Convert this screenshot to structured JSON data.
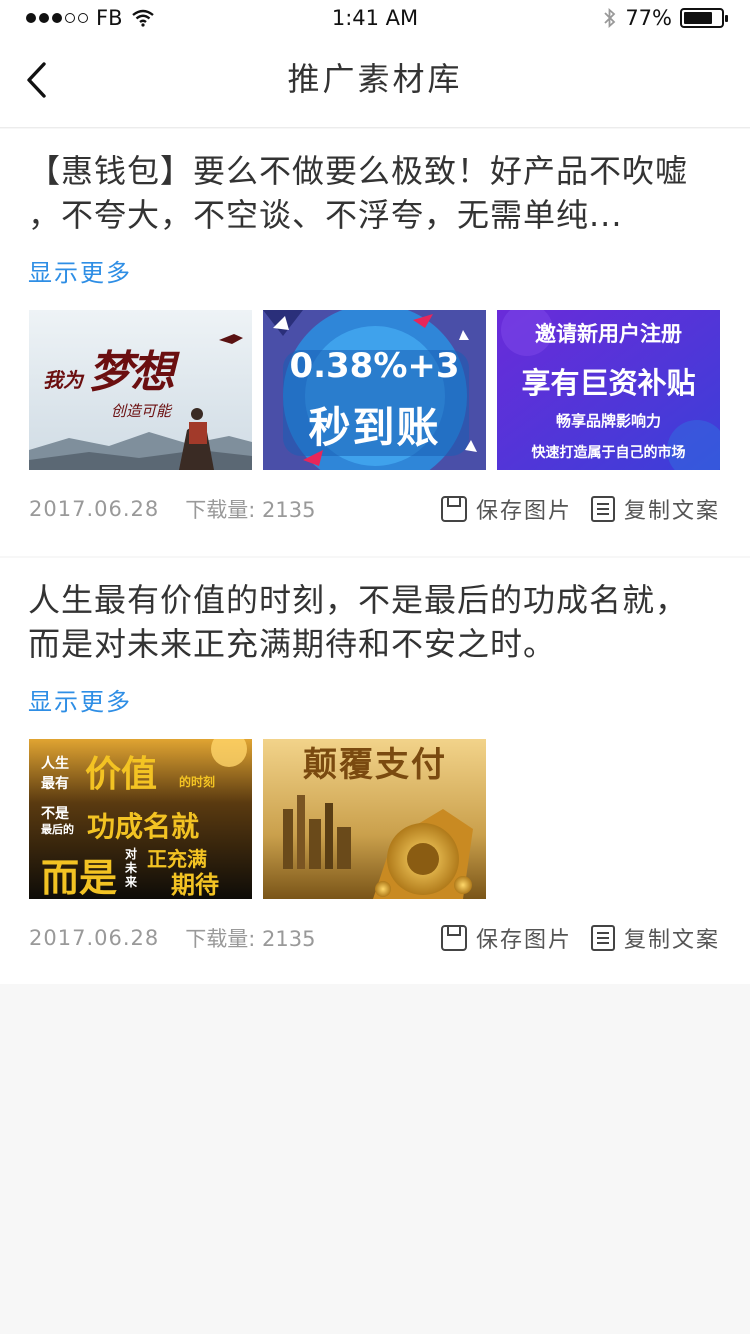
{
  "status_bar": {
    "carrier": "FB",
    "time": "1:41 AM",
    "battery": "77%",
    "battery_level": 0.77
  },
  "nav": {
    "title": "推广素材库"
  },
  "posts": [
    {
      "line1": "【惠钱包】要么不做要么极致！好产品不吹嘘",
      "line2": "，不夸大，不空谈、不浮夸，无需单纯...",
      "show_more": "显示更多",
      "date": "2017.06.28",
      "downloads": "下载量: 2135",
      "save_label": "保存图片",
      "copy_label": "复制文案",
      "images": [
        {
          "line1": "我为",
          "line2": "梦想",
          "line3": "创造可能"
        },
        {
          "line1": "0.38%+3",
          "line2": "秒到账"
        },
        {
          "line1": "邀请新用户注册",
          "line2": "享有巨资补贴",
          "line3": "畅享品牌影响力",
          "line4": "快速打造属于自己的市场"
        }
      ]
    },
    {
      "line1": "人生最有价值的时刻，不是最后的功成名就，",
      "line2": "而是对未来正充满期待和不安之时。",
      "show_more": "显示更多",
      "date": "2017.06.28",
      "downloads": "下载量: 2135",
      "save_label": "保存图片",
      "copy_label": "复制文案",
      "images": [
        {
          "line1": "人生",
          "line2": "价值",
          "line3": "最有",
          "line4": "的时刻",
          "line5": "不是",
          "line6": "最后的",
          "line7": "功成名就",
          "line8": "而是",
          "line9": "对未来",
          "line10": "正充满",
          "line11": "期待"
        },
        {
          "line1": "颠覆支付"
        }
      ]
    }
  ]
}
